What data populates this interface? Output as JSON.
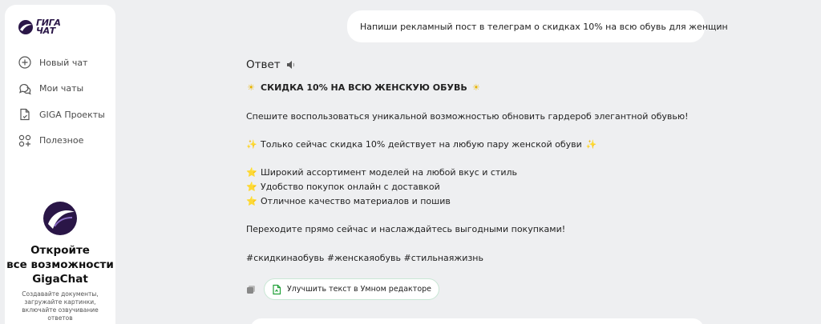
{
  "app": {
    "logo_text_line1": "ГИГА",
    "logo_text_line2": "ЧАТ"
  },
  "sidebar": {
    "items": [
      {
        "label": "Новый чат",
        "icon": "plus-circle-icon"
      },
      {
        "label": "Мои чаты",
        "icon": "chat-bubbles-icon"
      },
      {
        "label": "GIGA Проекты",
        "icon": "project-icon"
      },
      {
        "label": "Полезное",
        "icon": "grid-plus-icon"
      }
    ],
    "promo": {
      "title_line1": "Откройте",
      "title_line2": "все возможности",
      "title_line3": "GigaChat",
      "desc_line1": "Создавайте документы,",
      "desc_line2": "загружайте картинки,",
      "desc_line3": "включайте озвучивание",
      "desc_line4": "ответов"
    }
  },
  "chat": {
    "user_message": "Напиши рекламный пост в телеграм о скидках 10% на всю обувь для женщин",
    "answer_title": "Ответ",
    "answer": {
      "heading": "СКИДКА 10% НА ВСЮ ЖЕНСКУЮ ОБУВЬ",
      "heading_emoji": "☀",
      "intro": "Спешите воспользоваться уникальной возможностью обновить гардероб элегантной обувью!",
      "offer": "Только сейчас скидка 10% действует на любую пару женской обуви",
      "offer_emoji": "✨",
      "bullets": [
        "Широкий ассортимент моделей на любой вкус и стиль",
        "Удобство покупок онлайн с доставкой",
        "Отличное качество материалов и пошив"
      ],
      "bullet_emoji": "⭐",
      "cta": "Переходите прямо сейчас и наслаждайтесь выгодными покупками!",
      "hashtags": "#скидкинаобувь #женскаяобувь #стильнаяжизнь"
    },
    "improve_button": "Улучшить текст в Умном редакторе"
  },
  "colors": {
    "brand": "#2a1647",
    "accent_green": "#21a038",
    "background": "#eeeff1"
  }
}
